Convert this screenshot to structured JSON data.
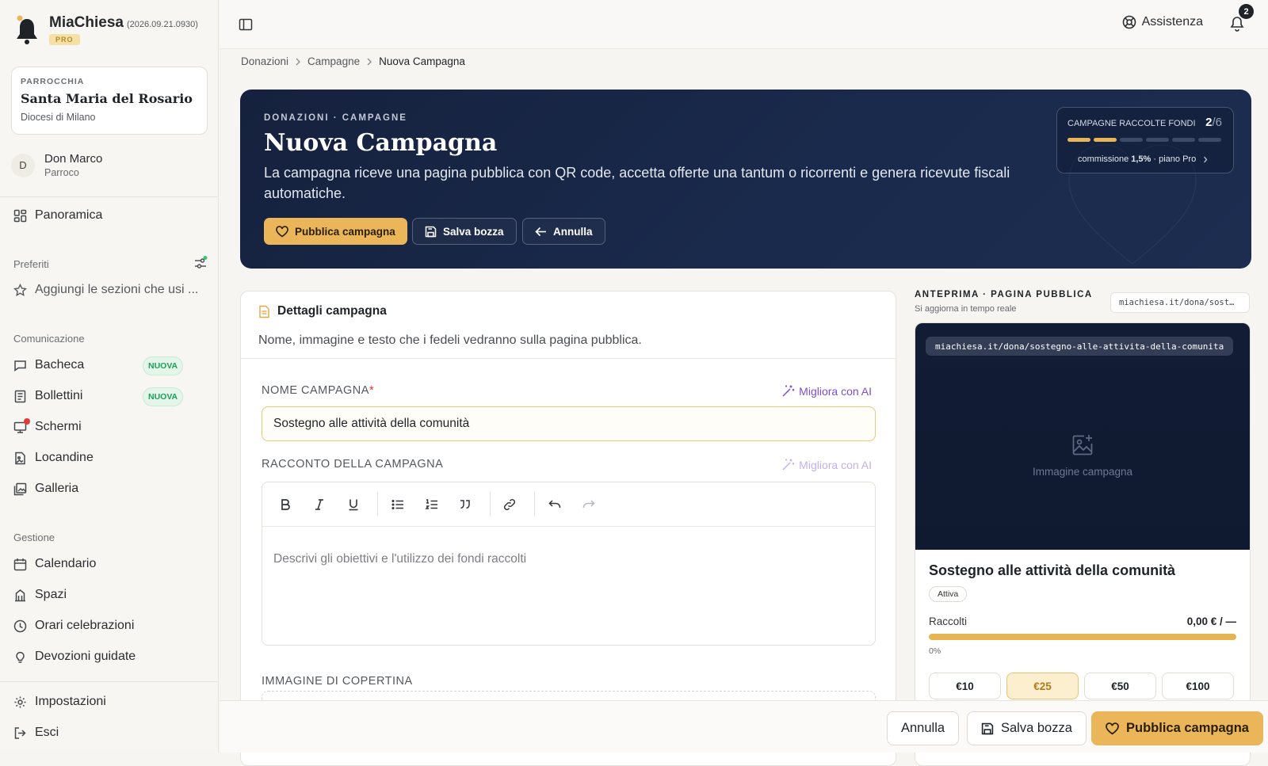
{
  "app": {
    "name": "MiaChiesa",
    "version": "(2026.09.21.0930)",
    "plan_badge": "PRO"
  },
  "parish": {
    "label": "PARROCCHIA",
    "name": "Santa Maria del Rosario",
    "diocese": "Diocesi di Milano"
  },
  "user": {
    "initial": "D",
    "name": "Don Marco",
    "role": "Parroco"
  },
  "sidebar": {
    "overview": "Panoramica",
    "favorites_title": "Preferiti",
    "favorites_add": "Aggiungi le sezioni che usi ...",
    "communication_title": "Comunicazione",
    "communication": [
      {
        "label": "Bacheca",
        "badge": "NUOVA",
        "icon": "message-icon"
      },
      {
        "label": "Bollettini",
        "badge": "NUOVA",
        "icon": "newspaper-icon"
      },
      {
        "label": "Schermi",
        "badge": "",
        "icon": "monitor-icon"
      },
      {
        "label": "Locandine",
        "badge": "",
        "icon": "file-image-icon"
      },
      {
        "label": "Galleria",
        "badge": "",
        "icon": "gallery-icon"
      }
    ],
    "management_title": "Gestione",
    "management": [
      {
        "label": "Calendario",
        "icon": "calendar-icon"
      },
      {
        "label": "Spazi",
        "icon": "building-icon"
      },
      {
        "label": "Orari celebrazioni",
        "icon": "clock-icon"
      },
      {
        "label": "Devozioni guidate",
        "icon": "lightbulb-icon"
      }
    ],
    "settings": "Impostazioni",
    "logout": "Esci"
  },
  "topbar": {
    "help": "Assistenza",
    "notifications_count": "2"
  },
  "breadcrumb": [
    "Donazioni",
    "Campagne",
    "Nuova Campagna"
  ],
  "hero": {
    "kicker": "DONAZIONI · CAMPAGNE",
    "title": "Nuova Campagna",
    "description": "La campagna riceve una pagina pubblica con QR code, accetta offerte una tantum o ricorrenti e genera ricevute fiscali automatiche.",
    "publish": "Pubblica campagna",
    "save_draft": "Salva bozza",
    "cancel": "Annulla",
    "quota": {
      "label": "CAMPAGNE RACCOLTE FONDI",
      "used": "2",
      "total": "/6",
      "used_value": 2,
      "total_value": 6,
      "commission_prefix": "commissione ",
      "commission": "1,5%",
      "plan": " · piano Pro"
    }
  },
  "details": {
    "title": "Dettagli campagna",
    "subtitle": "Nome, immagine e testo che i fedeli vedranno sulla pagina pubblica.",
    "name_label": "NOME CAMPAGNA",
    "required_mark": "*",
    "ai_improve": "Migliora con AI",
    "name_value": "Sostegno alle attività della comunità",
    "story_label": "RACCONTO DELLA CAMPAGNA",
    "story_placeholder": "Descrivi gli obiettivi e l'utilizzo dei fondi raccolti",
    "cover_label": "IMMAGINE DI COPERTINA"
  },
  "preview": {
    "kicker": "ANTEPRIMA · PAGINA PUBBLICA",
    "subtitle": "Si aggiorna in tempo reale",
    "url_short": "miachiesa.it/dona/sost…",
    "url_full": "miachiesa.it/dona/sostegno-alle-attivita-della-comunita",
    "image_placeholder": "Immagine campagna",
    "title": "Sostegno alle attività della comunità",
    "status": "Attiva",
    "raised_label": "Raccolti",
    "raised_value": "0,00 € / —",
    "percent": "0%",
    "amounts": [
      "€10",
      "€25",
      "€50",
      "€100"
    ],
    "selected_amount": "€25"
  },
  "footer": {
    "cancel": "Annulla",
    "save_draft": "Salva bozza",
    "publish": "Pubblica campagna"
  },
  "colors": {
    "accent": "#eab659",
    "hero_bg": "#172440",
    "ai": "#7c4dd6",
    "badge_green": "#1e9e58"
  }
}
